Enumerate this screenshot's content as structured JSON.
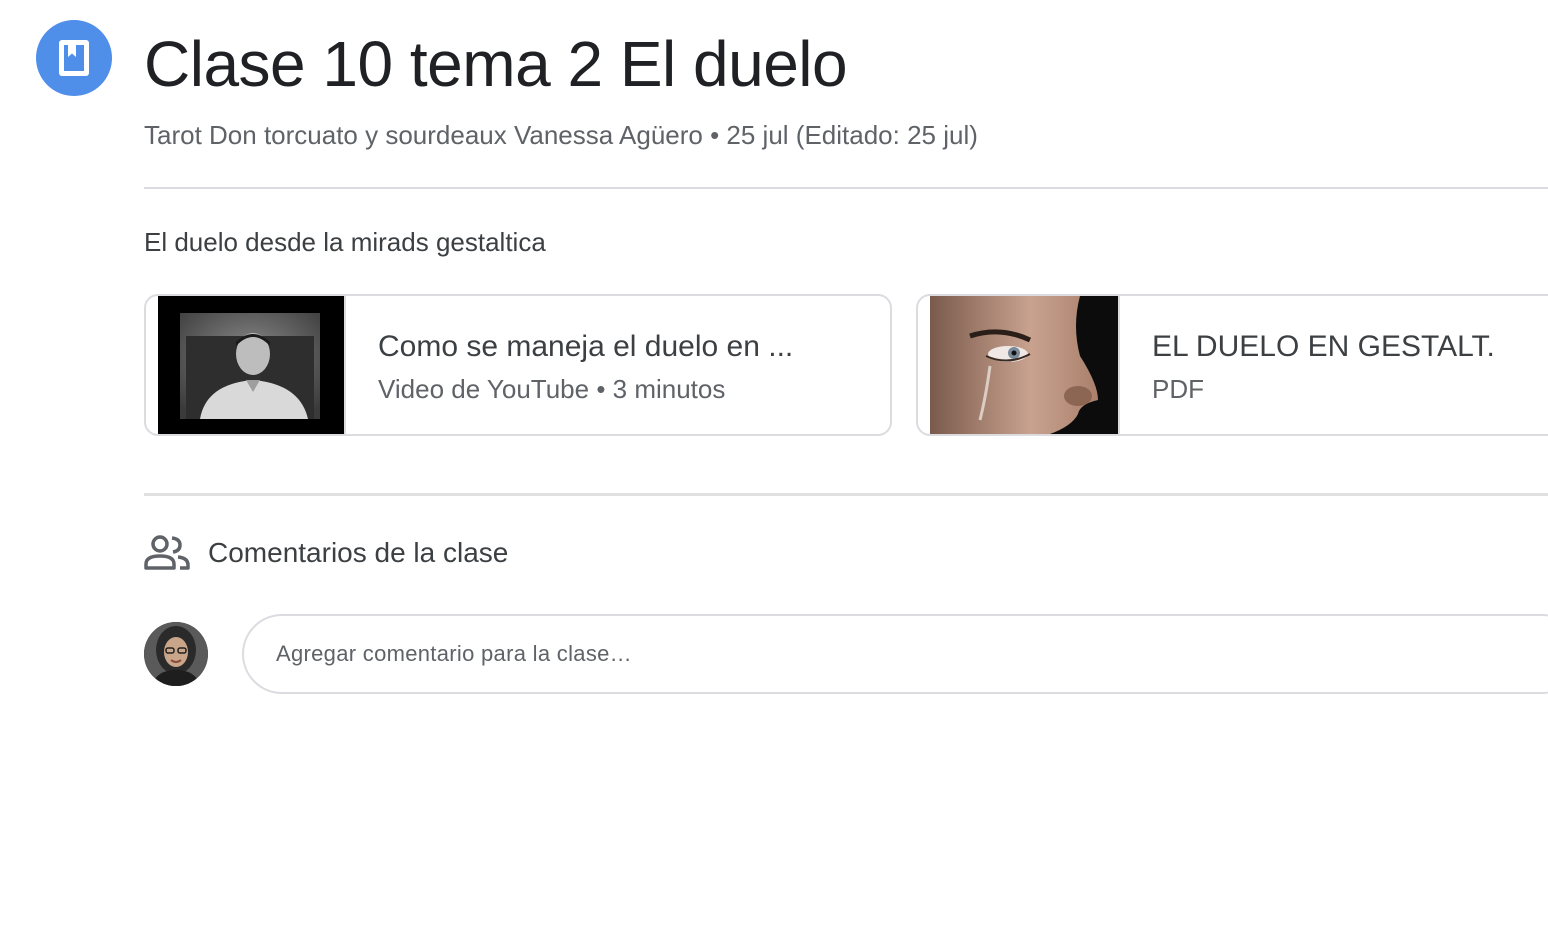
{
  "post": {
    "icon": "bookmark-material-icon",
    "title": "Clase 10 tema 2 El duelo",
    "meta": "Tarot Don torcuato y sourdeaux Vanessa Agüero • 25 jul (Editado: 25 jul)",
    "description": "El duelo desde la mirads gestaltica"
  },
  "attachments": [
    {
      "title": "Como se maneja el duelo en ...",
      "subtitle": "Video de YouTube • 3 minutos",
      "thumbnail": "video-thumbnail"
    },
    {
      "title": "EL DUELO EN GESTALT.",
      "subtitle": "PDF",
      "thumbnail": "pdf-thumbnail"
    }
  ],
  "comments": {
    "icon": "people-icon",
    "header": "Comentarios de la clase",
    "placeholder": "Agregar comentario para la clase…"
  },
  "colors": {
    "accent": "#4f8ee9",
    "border": "#dadce0",
    "text_primary": "#202124",
    "text_secondary": "#5f6368"
  }
}
